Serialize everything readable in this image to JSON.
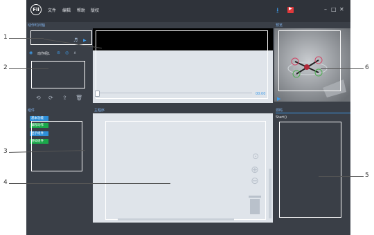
{
  "app": {
    "logo_text": "Fii",
    "menu": [
      "文件",
      "编辑",
      "帮助",
      "版权"
    ],
    "window_controls": {
      "minimize": "–",
      "maximize": "□",
      "close": "✕"
    }
  },
  "panels": {
    "timeline_title": "动作时间轴",
    "action_group": "动作组1",
    "preview_title": "预览",
    "components_title": "组件",
    "main_program_title": "主程序",
    "source_title": "源码",
    "source_text": "Start()",
    "time_display": "00:00"
  },
  "categories": [
    {
      "label": "基本功能",
      "color": "#2e8fd8"
    },
    {
      "label": "编程动作",
      "color": "#1aa84a"
    },
    {
      "label": "显示组件",
      "color": "#2e8fd8"
    },
    {
      "label": "感知组件",
      "color": "#1aa84a"
    }
  ],
  "callouts": [
    "1",
    "2",
    "3",
    "4",
    "5",
    "6"
  ],
  "icons": {
    "music": "♬",
    "play": "▶",
    "eye": "◉",
    "layers": "⊜",
    "location": "◎",
    "chevron_up": "∧",
    "undo": "⟲",
    "redo": "⟳",
    "export": "⇪",
    "delete": "🗑",
    "target": "⊙",
    "zoom_in": "⊕",
    "zoom_out": "⊖",
    "download": "⭳",
    "record": "▶"
  },
  "colors": {
    "app_bg": "#3a3f47",
    "toolbar_bg": "#2f333a",
    "panel_light": "#dfe4ea",
    "header_text": "#7fb0e8",
    "accent_blue": "#2e8fd8",
    "record_red": "#e0393b"
  }
}
